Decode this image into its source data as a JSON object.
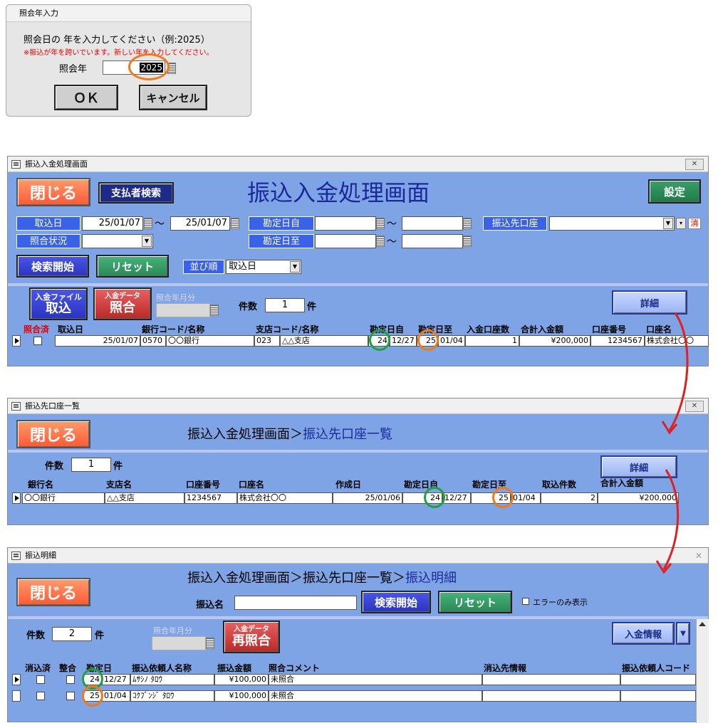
{
  "dialog": {
    "title": "照会年入力",
    "prompt": "照会日の 年を入力してください（例:2025）",
    "warning": "※振込が年を跨いでいます。新しい年を入力してください。",
    "year_label": "照会年",
    "year_value": "2025",
    "ok_label": "ＯＫ",
    "cancel_label": "キャンセル"
  },
  "win1": {
    "titlebar": "振込入金処理画面",
    "close_label": "閉じる",
    "payer_search_label": "支払者検索",
    "title": "振込入金処理画面",
    "settings_label": "設定",
    "filters": {
      "torikomi_label": "取込日",
      "date_from": "25/01/07",
      "tilde": "～",
      "date_to": "25/01/07",
      "kanjo_from_label": "勘定日自",
      "kanjo_to_label": "勘定日至",
      "account_label": "振込先口座",
      "clear_label": "消",
      "status_label": "照合状況"
    },
    "search_label": "検索開始",
    "reset_label": "リセット",
    "sort_label": "並び順",
    "sort_value": "取込日",
    "import_file_small": "入金ファイル",
    "import_file_big": "取込",
    "match_small": "入金データ",
    "match_big": "照合",
    "match_month_label": "照合年月分",
    "count_label": "件数",
    "count_value": "1",
    "count_unit": "件",
    "detail_label": "詳細",
    "columns": [
      "照合済",
      "取込日",
      "銀行コード/名称",
      "支店コード/名称",
      "勘定日自",
      "勘定日至",
      "入金口座数",
      "合計入金額",
      "口座番号",
      "口座名"
    ],
    "row": {
      "torikomi": "25/01/07",
      "bank_code": "0570",
      "bank_name": "〇〇銀行",
      "branch_code": "023",
      "branch_name": "△△支店",
      "from_yy": "24",
      "from_md": "12/27",
      "to_yy": "25",
      "to_md": "01/04",
      "accounts": "1",
      "total": "¥200,000",
      "acct_no": "1234567",
      "acct_name": "株式会社〇〇"
    }
  },
  "win2": {
    "titlebar": "振込先口座一覧",
    "close_label": "閉じる",
    "title_prefix": "振込入金処理画面＞",
    "title_current": "振込先口座一覧",
    "count_label": "件数",
    "count_value": "1",
    "count_unit": "件",
    "detail_label": "詳細",
    "columns": [
      "銀行名",
      "支店名",
      "口座番号",
      "口座名",
      "作成日",
      "勘定日自",
      "勘定日至",
      "取込件数",
      "合計入金額"
    ],
    "row": {
      "bank": "〇〇銀行",
      "branch": "△△支店",
      "acct_no": "1234567",
      "acct_name": "株式会社〇〇",
      "created": "25/01/06",
      "from_yy": "24",
      "from_md": "12/27",
      "to_yy": "25",
      "to_md": "01/04",
      "count": "2",
      "total": "¥200,000"
    }
  },
  "win3": {
    "titlebar": "振込明細",
    "close_label": "閉じる",
    "title_prefix": "振込入金処理画面＞振込先口座一覧＞",
    "title_current": "振込明細",
    "name_label": "振込名",
    "search_label": "検索開始",
    "reset_label": "リセット",
    "error_only_label": "エラーのみ表示",
    "count_label": "件数",
    "count_value": "2",
    "count_unit": "件",
    "match_month_label": "照合年月分",
    "rematch_small": "入金データ",
    "rematch_big": "再照合",
    "info_label": "入金情報",
    "columns": [
      "消込済",
      "整合",
      "勘定日",
      "振込依頼人名称",
      "振込金額",
      "照合コメント",
      "消込先情報",
      "振込依頼人コード"
    ],
    "rows": [
      {
        "yy": "24",
        "md": "12/27",
        "name": "ﾑｻｼﾉ ﾀﾛｳ",
        "amount": "¥100,000",
        "comment": "未照合"
      },
      {
        "yy": "25",
        "md": "01/04",
        "name": "ｺｸﾌﾞﾝｼﾞ ﾀﾛｳ",
        "amount": "¥100,000",
        "comment": "未照合"
      }
    ]
  },
  "colors": {
    "window_bg": "#7fa4e6",
    "ring_green": "#20a040",
    "ring_orange": "#f07a1a",
    "arrow_red": "#e02020"
  }
}
